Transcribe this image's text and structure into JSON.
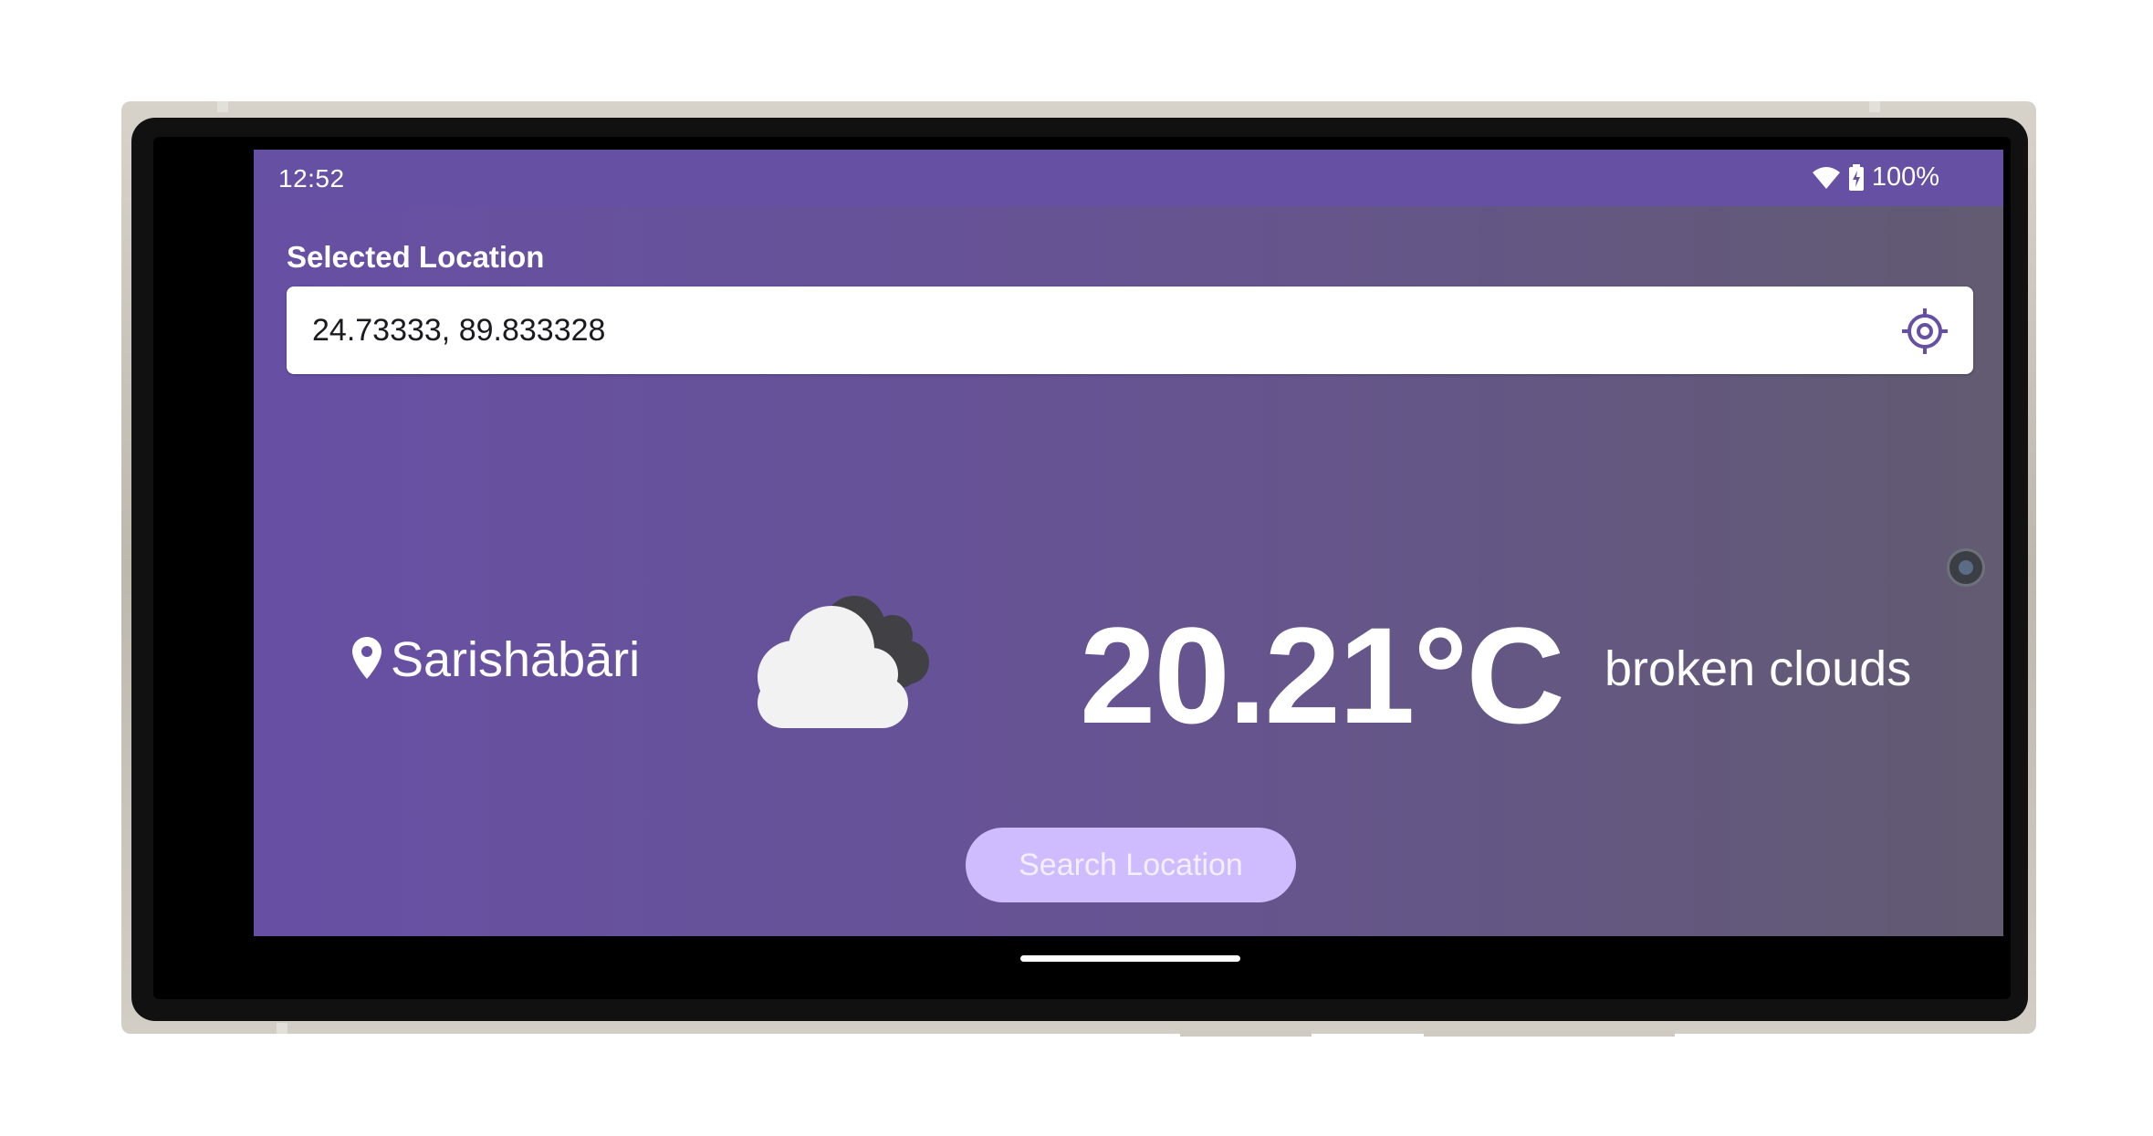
{
  "status_bar": {
    "time": "12:52",
    "battery_percent": "100%",
    "icons": [
      "wifi-icon",
      "battery-charging-icon"
    ]
  },
  "location": {
    "label": "Selected Location",
    "value": "24.73333, 89.833328",
    "action_icon": "gps-target-icon"
  },
  "weather": {
    "place": "Sarishābāri",
    "place_icon": "location-pin-icon",
    "condition_icon": "broken-clouds-icon",
    "temperature": "20.21°C",
    "condition": "broken clouds"
  },
  "actions": {
    "search_label": "Search Location"
  },
  "colors": {
    "primary": "#6750a4",
    "status_bar": "#6650a4",
    "button": "#cfbcff"
  }
}
